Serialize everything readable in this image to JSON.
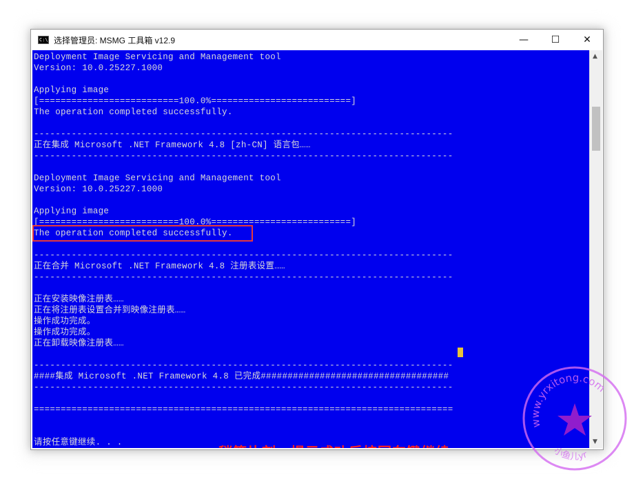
{
  "window": {
    "icon_text": "C:\\",
    "title": "选择管理员: MSMG 工具箱 v12.9",
    "minimize": "—",
    "maximize": "☐",
    "close": "✕"
  },
  "console": {
    "lines": [
      "Deployment Image Servicing and Management tool",
      "Version: 10.0.25227.1000",
      "",
      "Applying image",
      "[==========================100.0%==========================]",
      "The operation completed successfully.",
      "",
      "------------------------------------------------------------------------------",
      "正在集成 Microsoft .NET Framework 4.8 [zh-CN] 语言包……",
      "------------------------------------------------------------------------------",
      "",
      "Deployment Image Servicing and Management tool",
      "Version: 10.0.25227.1000",
      "",
      "Applying image",
      "[==========================100.0%==========================]",
      "The operation completed successfully.",
      "",
      "------------------------------------------------------------------------------",
      "正在合并 Microsoft .NET Framework 4.8 注册表设置……",
      "------------------------------------------------------------------------------",
      "",
      "正在安装映像注册表……",
      "正在将注册表设置合并到映像注册表……",
      "操作成功完成。",
      "操作成功完成。",
      "正在卸载映像注册表……",
      "",
      "------------------------------------------------------------------------------",
      "####集成 Microsoft .NET Framework 4.8 已完成###################################",
      "------------------------------------------------------------------------------",
      "",
      "==============================================================================",
      "",
      "",
      "请按任意键继续. . ."
    ]
  },
  "annotation": "稍等片刻，提示成功后按回车键继续",
  "watermark": {
    "text": "www.yrxitong.com",
    "sub": "小鱼儿yr",
    "color": "#cc44ee"
  },
  "colors": {
    "console_bg": "#0000ee",
    "console_text": "#d9d9d9",
    "highlight": "#e63a3a",
    "annotation": "#ff1f1f",
    "cursor": "#e6c23a"
  }
}
